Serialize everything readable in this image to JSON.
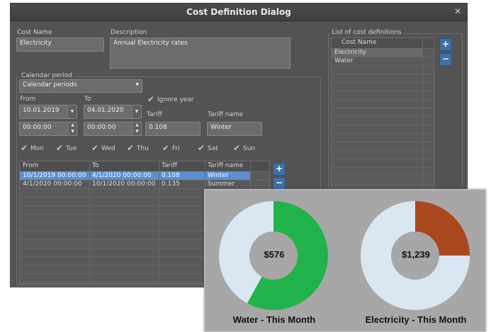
{
  "dialog": {
    "title": "Cost Definition Dialog",
    "close_icon": "close-icon",
    "cost_name_label": "Cost Name",
    "cost_name_value": "Electricity",
    "description_label": "Description",
    "description_value": "Annual Electricity rates",
    "calendar_period_label": "Calendar period",
    "calendar_period_value": "Calendar periods",
    "from_label": "From",
    "to_label": "To",
    "from_date": "10.01.2019",
    "to_date": "04.01.2020",
    "from_time": "00:00:00",
    "to_time": "00:00:00",
    "ignore_year_label": "Ignore year",
    "tariff_label": "Tariff",
    "tariff_value": "0.108",
    "tariff_name_label": "Tariff name",
    "tariff_name_value": "Winter",
    "days": [
      {
        "label": "Mon",
        "checked": true
      },
      {
        "label": "Tue",
        "checked": true
      },
      {
        "label": "Wed",
        "checked": true
      },
      {
        "label": "Thu",
        "checked": true
      },
      {
        "label": "Fri",
        "checked": true
      },
      {
        "label": "Sat",
        "checked": true
      },
      {
        "label": "Sun",
        "checked": true
      }
    ],
    "periods_table": {
      "columns": [
        "From",
        "To",
        "Tariff",
        "Tariff name"
      ],
      "rows": [
        [
          "10/1/2019 00:00:00",
          "4/1/2020 00:00:00",
          "0.108",
          "Winter"
        ],
        [
          "4/1/2020 00:00:00",
          "10/1/2020 00:00:00",
          "0.135",
          "Summer"
        ]
      ],
      "selected_row": 0
    },
    "definitions_label": "List of cost definitions",
    "definitions_table": {
      "column": "Cost Name",
      "rows": [
        "Electricity",
        "Water"
      ],
      "selected_row": 0
    },
    "add_symbol": "+",
    "remove_symbol": "−",
    "accent_color": "#5b8fd0"
  },
  "chart_data": [
    {
      "type": "pie",
      "caption": "Water - This Month",
      "center_value": "$576",
      "fill_fraction": 0.58,
      "colors": {
        "filled": "#22b24c",
        "remaining": "#dbe6f3",
        "hole": "#a7a7a7"
      }
    },
    {
      "type": "pie",
      "caption": "Electricity - This Month",
      "center_value": "$1,239",
      "fill_fraction": 0.25,
      "colors": {
        "filled": "#a9481e",
        "remaining": "#dbe6f3",
        "hole": "#a7a7a7"
      }
    }
  ]
}
